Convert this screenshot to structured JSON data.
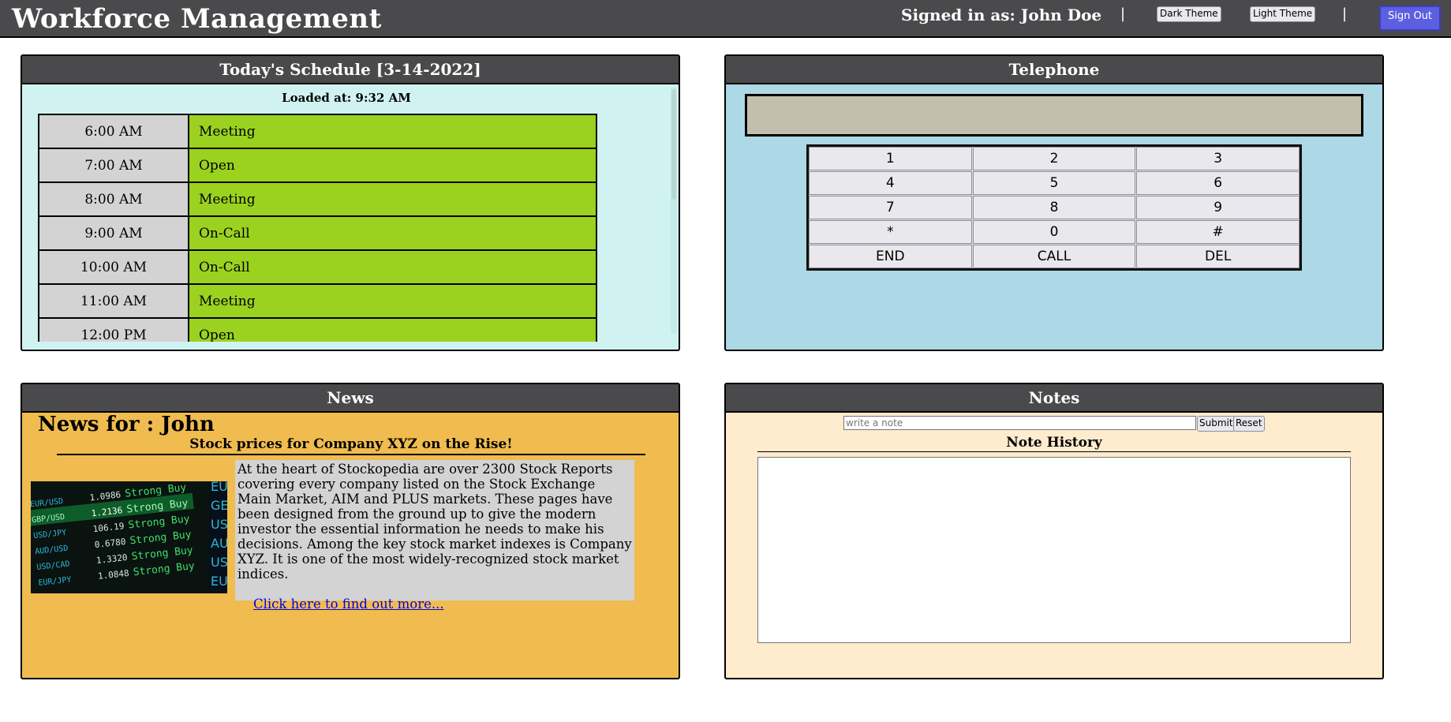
{
  "header": {
    "app_title": "Workforce Management",
    "signed_in": "Signed in as: John Doe",
    "separator": "|",
    "dark_theme_label": "Dark Theme",
    "light_theme_label": "Light Theme",
    "sign_out_label": "Sign Out"
  },
  "colors": {
    "header_bg": "#4a4a4c",
    "schedule_bg": "#d0f3f1",
    "schedule_event": "#9ad21f",
    "telephone_bg": "#add8e6",
    "news_bg": "#f0bc4f",
    "notes_bg": "#ffebcd",
    "sign_out_bg": "#5b5fe0"
  },
  "schedule": {
    "title": "Today's Schedule [3-14-2022]",
    "loaded_at": "Loaded at: 9:32 AM",
    "rows": [
      {
        "time": "6:00 AM",
        "event": "Meeting"
      },
      {
        "time": "7:00 AM",
        "event": "Open"
      },
      {
        "time": "8:00 AM",
        "event": "Meeting"
      },
      {
        "time": "9:00 AM",
        "event": "On-Call"
      },
      {
        "time": "10:00 AM",
        "event": "On-Call"
      },
      {
        "time": "11:00 AM",
        "event": "Meeting"
      },
      {
        "time": "12:00 PM",
        "event": "Open"
      }
    ]
  },
  "telephone": {
    "title": "Telephone",
    "display_value": "",
    "keys": [
      "1",
      "2",
      "3",
      "4",
      "5",
      "6",
      "7",
      "8",
      "9",
      "*",
      "0",
      "#",
      "END",
      "CALL",
      "DEL"
    ]
  },
  "news": {
    "title": "News",
    "news_for": "News for : John",
    "headline": "Stock prices for Company XYZ on the Rise!",
    "image_icon": "stock-ticker-image",
    "body": "At the heart of Stockopedia are over 2300 Stock Reports covering every company listed on the Stock Exchange Main Market, AIM and PLUS markets. These pages have been designed from the ground up to give the modern investor the essential information he needs to make his decisions. Among the key stock market indexes is Company XYZ. It is one of the most widely-recognized stock market indices.",
    "link_text": "Click here to find out more..."
  },
  "notes": {
    "title": "Notes",
    "input_placeholder": "write a note",
    "input_value": "",
    "submit_label": "Submit",
    "reset_label": "Reset",
    "history_title": "Note History",
    "history_items": []
  }
}
